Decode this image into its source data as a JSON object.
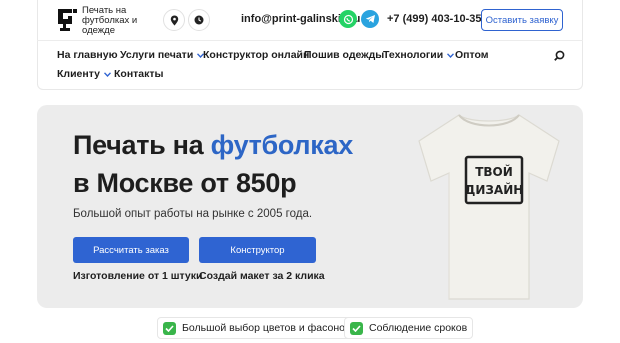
{
  "header": {
    "logo_text": "Печать на футболках и одежде",
    "email": "info@print-galinskiy.ru",
    "phone": "+7 (499) 403-10-35",
    "cta_label": "Оставить заявку",
    "icons": [
      "location-icon",
      "clock-icon",
      "whatsapp-icon",
      "telegram-icon"
    ]
  },
  "nav": {
    "items": [
      {
        "label": "На главную"
      },
      {
        "label": "Услуги печати"
      },
      {
        "label": "Конструктор онлайн"
      },
      {
        "label": "Пошив одежды"
      },
      {
        "label": "Технологии"
      },
      {
        "label": "Оптом"
      },
      {
        "label": "Клиенту"
      },
      {
        "label": "Контакты"
      }
    ]
  },
  "hero": {
    "title_line1_prefix": "Печать на ",
    "title_line1_accent": "футболках",
    "title_line2": "в Москве от 850р",
    "subtitle": "Большой опыт работы на рынке с 2005 года.",
    "buttons": [
      {
        "label": "Рассчитать заказ",
        "note": "Изготовление от 1 штуки"
      },
      {
        "label": "Конструктор",
        "note": "Создай макет за 2 клика"
      }
    ],
    "shirt_text_line1": "ТВОЙ",
    "shirt_text_line2": "ДИЗАЙН"
  },
  "features": [
    {
      "label": "Большой выбор цветов и фасонов"
    },
    {
      "label": "Соблюдение сроков"
    }
  ],
  "colors": {
    "accent": "#2d66c6",
    "button": "#2f64d2",
    "check": "#39b54a",
    "hero_bg": "#ececec",
    "whatsapp": "#25d366",
    "telegram": "#2aa3df"
  }
}
